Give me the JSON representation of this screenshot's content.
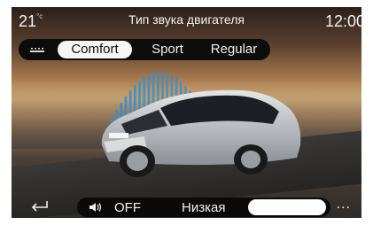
{
  "status_bar": {
    "temperature": "21",
    "temperature_unit": "°c",
    "title": "Тип звука двигателя",
    "time": "12:00"
  },
  "sound_modes": {
    "options": [
      "Comfort",
      "Sport",
      "Regular"
    ],
    "selected": "Comfort"
  },
  "bottom_bar": {
    "off_label": "OFF",
    "level_label": "Низкая",
    "more_label": "..."
  },
  "colors": {
    "accent_bars": "#2f8fd6",
    "background": "#000000",
    "selected_pill": "#f6f6f6"
  },
  "icons": [
    "settings-icon",
    "back-icon",
    "volume-icon",
    "more-icon"
  ]
}
